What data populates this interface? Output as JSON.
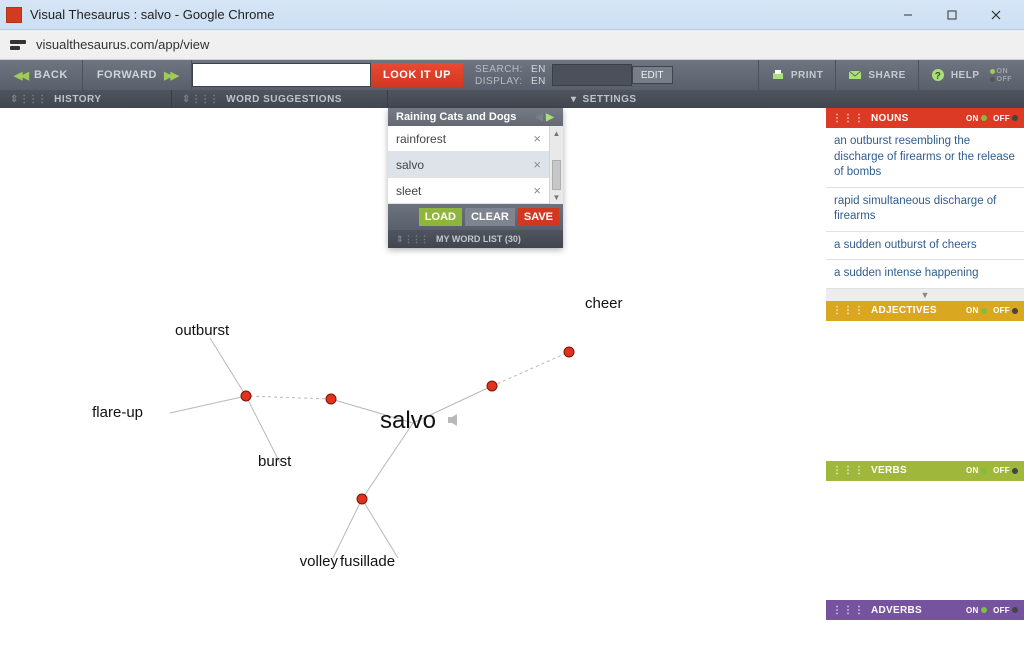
{
  "window": {
    "title": "Visual Thesaurus : salvo - Google Chrome",
    "url": "visualthesaurus.com/app/view"
  },
  "toolbar": {
    "back": "BACK",
    "forward": "FORWARD",
    "lookup": "LOOK IT UP",
    "search_label": "SEARCH:",
    "display_label": "DISPLAY:",
    "search_lang": "EN",
    "display_lang": "EN",
    "edit": "EDIT",
    "print": "PRINT",
    "share": "SHARE",
    "help": "HELP",
    "on": "ON",
    "off": "OFF"
  },
  "toolbar2": {
    "history": "HISTORY",
    "suggestions": "WORD SUGGESTIONS",
    "settings": "SETTINGS"
  },
  "wordlist": {
    "title": "Raining Cats and Dogs",
    "items": [
      "rainforest",
      "salvo",
      "sleet"
    ],
    "selected": "salvo",
    "load": "LOAD",
    "clear": "CLEAR",
    "save": "SAVE",
    "footer": "MY WORD LIST (30)"
  },
  "graph": {
    "center": "salvo",
    "nodes": [
      "outburst",
      "flare-up",
      "burst",
      "volley",
      "fusillade",
      "cheer"
    ]
  },
  "meanings": {
    "nouns_header": "NOUNS",
    "adj_header": "ADJECTIVES",
    "verbs_header": "VERBS",
    "adv_header": "ADVERBS",
    "on": "ON",
    "off": "OFF",
    "nouns": [
      "an outburst resembling the discharge of firearms or the release of bombs",
      "rapid simultaneous discharge of firearms",
      "a sudden outburst of cheers",
      "a sudden intense happening"
    ]
  }
}
